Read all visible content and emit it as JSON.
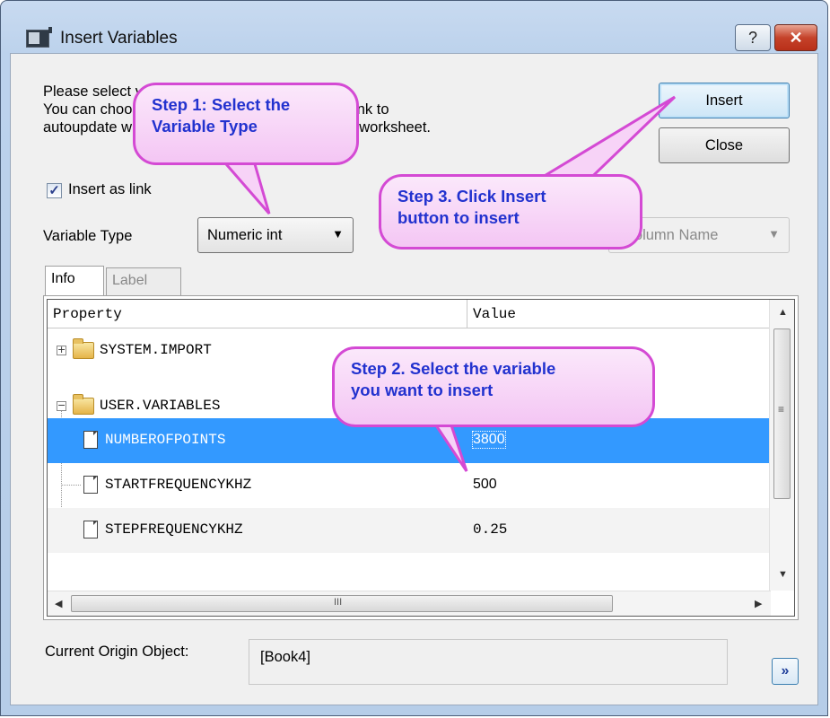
{
  "window": {
    "title": "Insert Variables",
    "help_label": "?",
    "close_label": "✕"
  },
  "description": {
    "line1": "Please select variables from the list below.",
    "line2": "You can choose to insert as text, or insert as a link to",
    "line3": "autoupdate when variables are inserted into the worksheet."
  },
  "buttons": {
    "insert_label": "Insert",
    "close_label": "Close"
  },
  "options": {
    "insert_as_link_label": "Insert as link",
    "insert_as_link_checked": true,
    "variable_type_label": "Variable Type",
    "variable_type_value": "Numeric int",
    "column_name_value": "Column Name"
  },
  "tabs": [
    {
      "label": "Info",
      "active": true
    },
    {
      "label": "Label",
      "active": false
    }
  ],
  "grid": {
    "headers": [
      "Property",
      "Value"
    ],
    "rows": [
      {
        "name": "SYSTEM.IMPORT",
        "value": "",
        "kind": "folder",
        "expander": "+"
      },
      {
        "name": "USER.VARIABLES",
        "value": "",
        "kind": "folder",
        "expander": "−"
      },
      {
        "name": "NUMBEROFPOINTS",
        "value": "3800",
        "kind": "item",
        "selected": true
      },
      {
        "name": "STARTFREQUENCYKHZ",
        "value": "500",
        "kind": "item"
      },
      {
        "name": "STEPFREQUENCYKHZ",
        "value": "0.25",
        "kind": "item"
      }
    ],
    "scroll_grip": "≡",
    "hscroll_grip": "III"
  },
  "current_origin": {
    "label": "Current Origin Object:",
    "value": "[Book4]",
    "more_label": "»"
  },
  "callouts": {
    "step1": "Step 1: Select the\nVariable  Type",
    "step2": "Step 2. Select the variable\nyou want to insert",
    "step3": "Step 3. Click Insert\nbutton to insert"
  },
  "colors": {
    "selection": "#3399ff",
    "callout_border": "#d44ad4",
    "callout_text": "#2232cf"
  }
}
